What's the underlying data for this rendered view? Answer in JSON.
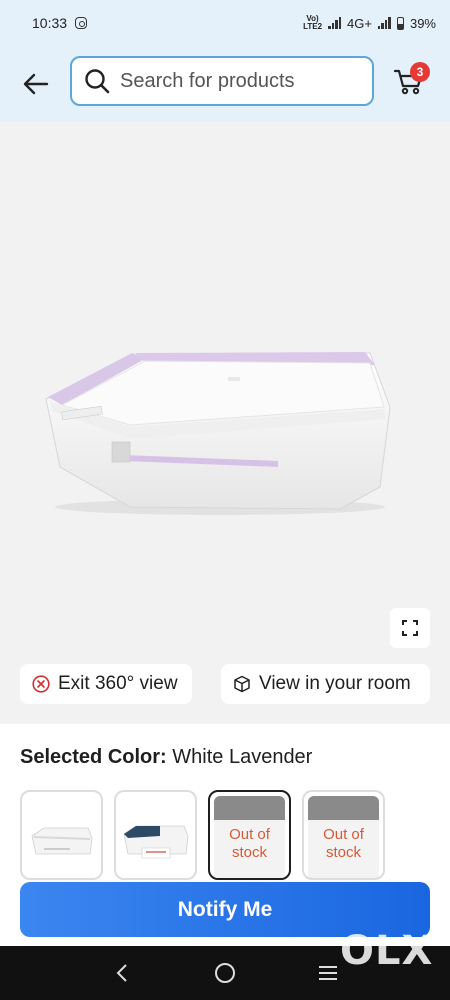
{
  "status_bar": {
    "time": "10:33",
    "network": "4G+",
    "battery": "39%"
  },
  "header": {
    "search_placeholder": "Search for products",
    "cart_count": "3"
  },
  "product_view": {
    "exit_360_label": "Exit 360° view",
    "view_in_room_label": "View in your room"
  },
  "color_selector": {
    "heading": "Selected Color:",
    "value": "White Lavender",
    "options": [
      {
        "status": "available"
      },
      {
        "status": "available"
      },
      {
        "status": "Out of stock",
        "selected": true
      },
      {
        "status": "Out of stock"
      }
    ],
    "oos_label_a": "Out of",
    "oos_label_b": "stock"
  },
  "cta": {
    "notify_label": "Notify Me"
  },
  "watermark": "OLX",
  "colors": {
    "header_bg": "#e4f1fb",
    "accent_blue": "#1a66e0",
    "badge_red": "#e53935",
    "oos_text": "#d65a36"
  }
}
